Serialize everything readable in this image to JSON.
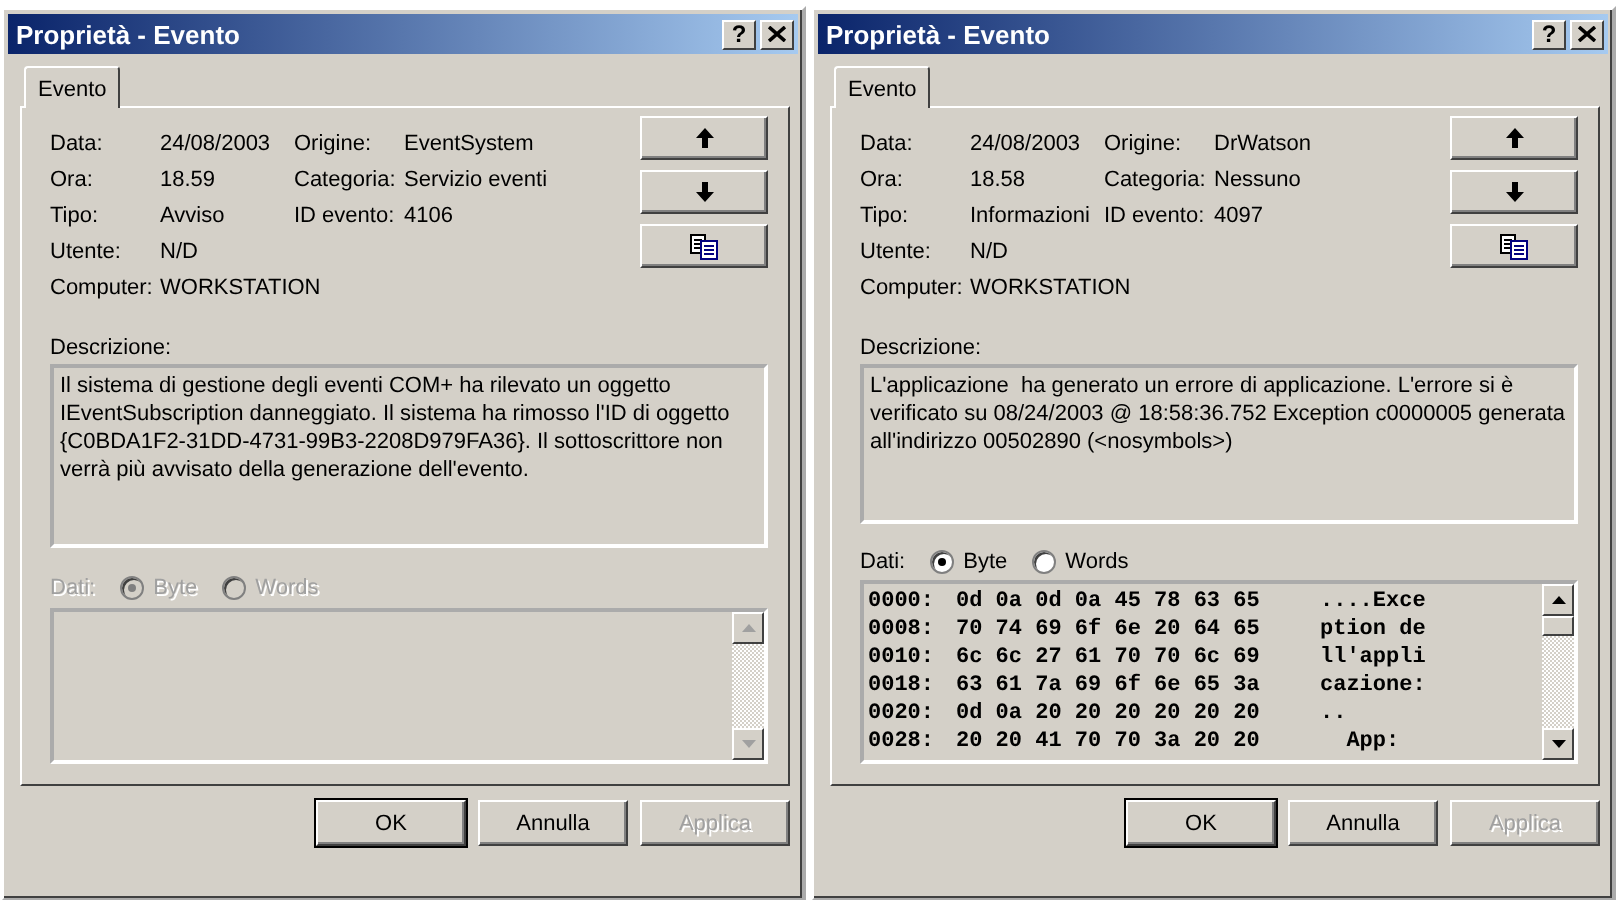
{
  "dialogs": [
    {
      "title": "Proprietà - Evento",
      "help_button": "?",
      "tab": {
        "label": "Evento",
        "selected": true
      },
      "details_left": [
        {
          "label": "Data:",
          "value": "24/08/2003"
        },
        {
          "label": "Ora:",
          "value": "18.59"
        },
        {
          "label": "Tipo:",
          "value": "Avviso"
        },
        {
          "label": "Utente:",
          "value": "N/D"
        },
        {
          "label": "Computer:",
          "value": "WORKSTATION"
        }
      ],
      "details_right": [
        {
          "label": "Origine:",
          "value": "EventSystem"
        },
        {
          "label": "Categoria:",
          "value": "Servizio eventi"
        },
        {
          "label": "ID evento:",
          "value": "4106"
        }
      ],
      "description_label": "Descrizione:",
      "description": "Il sistema di gestione degli eventi COM+ ha rilevato un oggetto IEventSubscription danneggiato. Il sistema ha rimosso l'ID di oggetto {C0BDA1F2-31DD-4731-99B3-2208D979FA36}. Il sottoscrittore non verrà più avvisato della generazione dell'evento.",
      "data": {
        "label": "Dati:",
        "disabled": true,
        "options": [
          {
            "label": "Byte",
            "selected": true
          },
          {
            "label": "Words",
            "selected": false
          }
        ]
      },
      "buttons": [
        {
          "label": "OK",
          "disabled": false,
          "default": true
        },
        {
          "label": "Annulla",
          "disabled": false,
          "default": false
        },
        {
          "label": "Applica",
          "disabled": true,
          "default": false
        }
      ]
    },
    {
      "title": "Proprietà - Evento",
      "help_button": "?",
      "tab": {
        "label": "Evento",
        "selected": true
      },
      "details_left": [
        {
          "label": "Data:",
          "value": "24/08/2003"
        },
        {
          "label": "Ora:",
          "value": "18.58"
        },
        {
          "label": "Tipo:",
          "value": "Informazioni"
        },
        {
          "label": "Utente:",
          "value": "N/D"
        },
        {
          "label": "Computer:",
          "value": "WORKSTATION"
        }
      ],
      "details_right": [
        {
          "label": "Origine:",
          "value": "DrWatson"
        },
        {
          "label": "Categoria:",
          "value": "Nessuno"
        },
        {
          "label": "ID evento:",
          "value": "4097"
        }
      ],
      "description_label": "Descrizione:",
      "description": "L'applicazione  ha generato un errore di applicazione. L'errore si è verificato su 08/24/2003 @ 18:58:36.752 Exception c0000005 generata all'indirizzo 00502890 (<nosymbols>)",
      "data": {
        "label": "Dati:",
        "disabled": false,
        "options": [
          {
            "label": "Byte",
            "selected": true
          },
          {
            "label": "Words",
            "selected": false
          }
        ],
        "rows": [
          {
            "offset": "0000:",
            "bytes": "0d 0a 0d 0a 45 78 63 65",
            "ascii": "....Exce"
          },
          {
            "offset": "0008:",
            "bytes": "70 74 69 6f 6e 20 64 65",
            "ascii": "ption de"
          },
          {
            "offset": "0010:",
            "bytes": "6c 6c 27 61 70 70 6c 69",
            "ascii": "ll'appli"
          },
          {
            "offset": "0018:",
            "bytes": "63 61 7a 69 6f 6e 65 3a",
            "ascii": "cazione:"
          },
          {
            "offset": "0020:",
            "bytes": "0d 0a 20 20 20 20 20 20",
            "ascii": ".."
          },
          {
            "offset": "0028:",
            "bytes": "20 20 41 70 70 3a 20 20",
            "ascii": "  App:"
          }
        ]
      },
      "buttons": [
        {
          "label": "OK",
          "disabled": false,
          "default": true
        },
        {
          "label": "Annulla",
          "disabled": false,
          "default": false
        },
        {
          "label": "Applica",
          "disabled": true,
          "default": false
        }
      ]
    }
  ]
}
